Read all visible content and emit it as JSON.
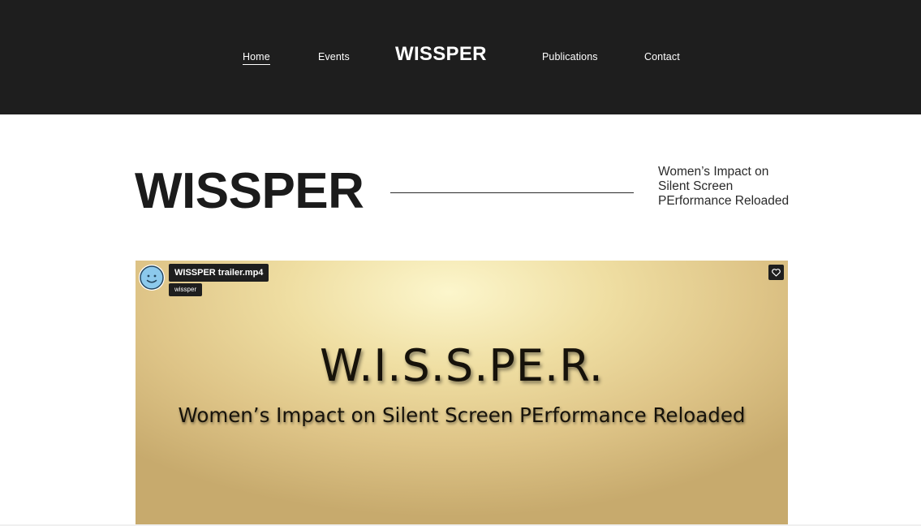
{
  "header": {
    "brand": "WISSPER",
    "nav": {
      "home": "Home",
      "events": "Events",
      "publications": "Publications",
      "contact": "Contact"
    }
  },
  "hero": {
    "title": "WISSPER",
    "subtitle": "Women’s Impact on Silent Screen PErformance Reloaded"
  },
  "video": {
    "filename": "WISSPER trailer.mp4",
    "channel": "wissper",
    "headline": "W.I.S.S.PE.R.",
    "tagline": "Women’s Impact on Silent Screen PErformance Reloaded",
    "icons": [
      "avatar-face-icon",
      "heart-icon"
    ]
  },
  "colors": {
    "header_bg": "#1e1e1e",
    "text_dark": "#1b1b1b",
    "video_gold": "#e6cf92",
    "avatar_blue": "#8cc9ec"
  }
}
